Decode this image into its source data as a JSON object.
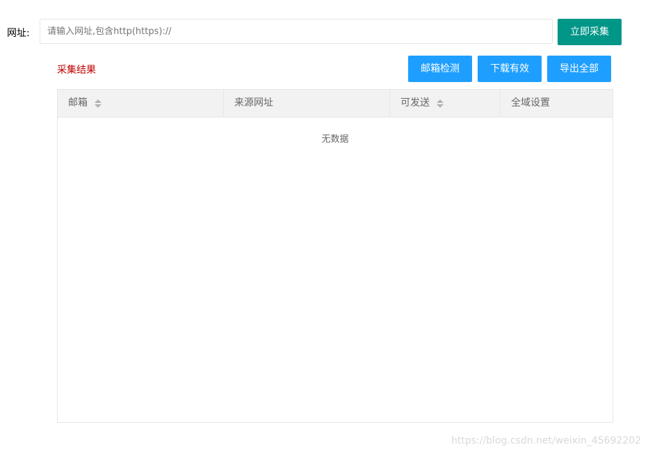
{
  "form": {
    "url_label": "网址:",
    "url_placeholder": "请输入网址,包含http(https)://",
    "url_value": "",
    "collect_button": "立即采集"
  },
  "results": {
    "title": "采集结果",
    "buttons": {
      "check_email": "邮箱检测",
      "download_valid": "下载有效",
      "export_all": "导出全部"
    }
  },
  "table": {
    "columns": [
      {
        "label": "邮箱",
        "sortable": true
      },
      {
        "label": "来源网址",
        "sortable": false
      },
      {
        "label": "可发送",
        "sortable": true
      },
      {
        "label": "全域设置",
        "sortable": false
      }
    ],
    "empty_text": "无数据"
  },
  "watermark": "https://blog.csdn.net/weixin_45692202",
  "colors": {
    "primary_green": "#009688",
    "primary_blue": "#1e9fff",
    "result_red": "#c00000"
  }
}
